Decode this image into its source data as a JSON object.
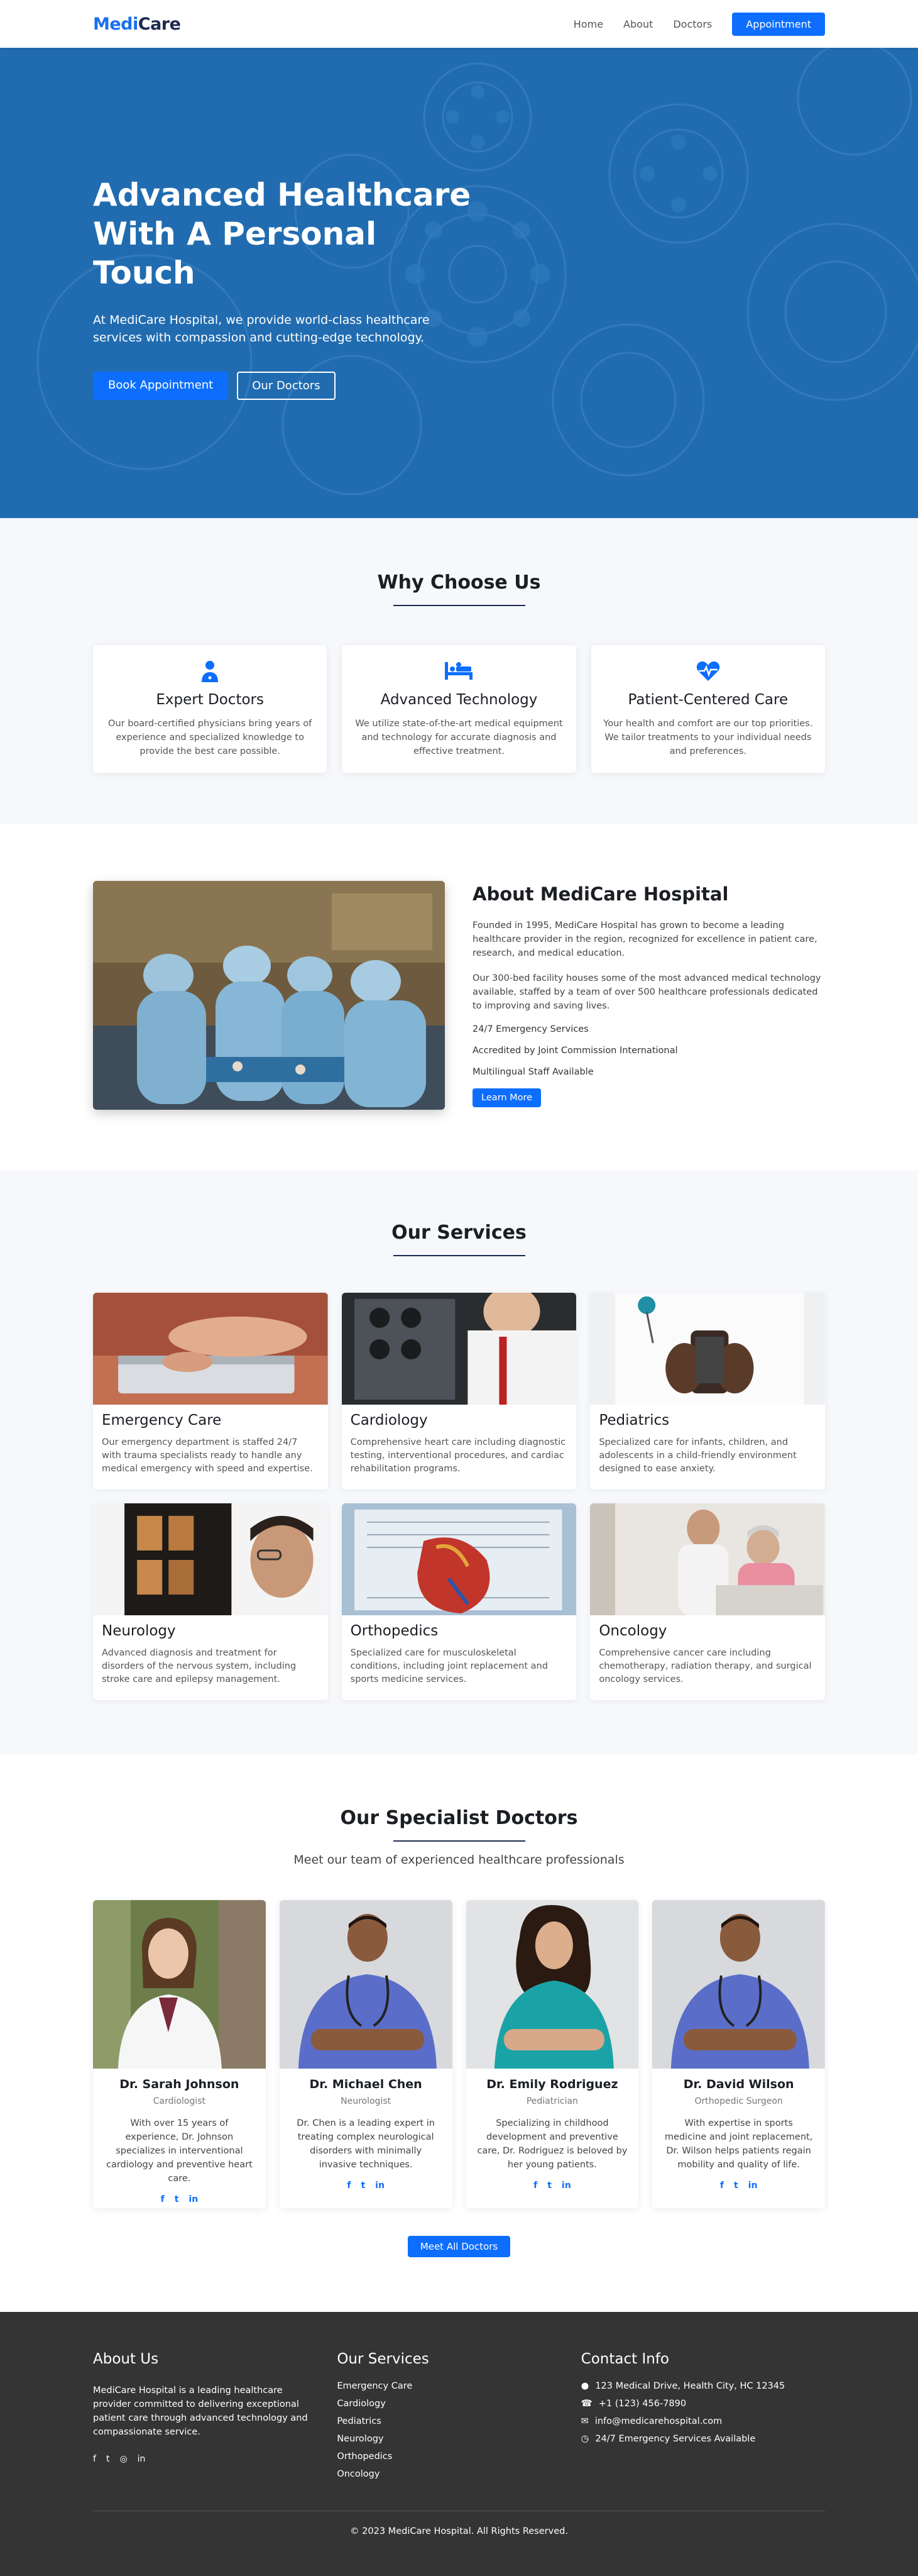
{
  "nav": {
    "logo_part1": "Medi",
    "logo_part2": "Care",
    "links": [
      "Home",
      "About",
      "Doctors"
    ],
    "cta": "Appointment"
  },
  "hero": {
    "title": "Advanced Healthcare With A Personal Touch",
    "description": "At MediCare Hospital, we provide world-class healthcare services with compassion and cutting-edge technology.",
    "primary_btn": "Book Appointment",
    "secondary_btn": "Our Doctors"
  },
  "why": {
    "title": "Why Choose Us",
    "cards": [
      {
        "icon": "doctor-icon",
        "title": "Expert Doctors",
        "text": "Our board-certified physicians bring years of experience and specialized knowledge to provide the best care possible."
      },
      {
        "icon": "hospital-bed-icon",
        "title": "Advanced Technology",
        "text": "We utilize state-of-the-art medical equipment and technology for accurate diagnosis and effective treatment."
      },
      {
        "icon": "heartbeat-icon",
        "title": "Patient-Centered Care",
        "text": "Your health and comfort are our top priorities. We tailor treatments to your individual needs and preferences."
      }
    ]
  },
  "about": {
    "title": "About MediCare Hospital",
    "para1": "Founded in 1995, MediCare Hospital has grown to become a leading healthcare provider in the region, recognized for excellence in patient care, research, and medical education.",
    "para2": "Our 300-bed facility houses some of the most advanced medical technology available, staffed by a team of over 500 healthcare professionals dedicated to improving and saving lives.",
    "features": [
      "24/7 Emergency Services",
      "Accredited by Joint Commission International",
      "Multilingual Staff Available"
    ],
    "button": "Learn More"
  },
  "services": {
    "title": "Our Services",
    "items": [
      {
        "title": "Emergency Care",
        "text": "Our emergency department is staffed 24/7 with trauma specialists ready to handle any medical emergency with speed and expertise."
      },
      {
        "title": "Cardiology",
        "text": "Comprehensive heart care including diagnostic testing, interventional procedures, and cardiac rehabilitation programs."
      },
      {
        "title": "Pediatrics",
        "text": "Specialized care for infants, children, and adolescents in a child-friendly environment designed to ease anxiety."
      },
      {
        "title": "Neurology",
        "text": "Advanced diagnosis and treatment for disorders of the nervous system, including stroke care and epilepsy management."
      },
      {
        "title": "Orthopedics",
        "text": "Specialized care for musculoskeletal conditions, including joint replacement and sports medicine services."
      },
      {
        "title": "Oncology",
        "text": "Comprehensive cancer care including chemotherapy, radiation therapy, and surgical oncology services."
      }
    ]
  },
  "doctors": {
    "title": "Our Specialist Doctors",
    "subtitle": "Meet our team of experienced healthcare professionals",
    "items": [
      {
        "name": "Dr. Sarah Johnson",
        "role": "Cardiologist",
        "bio": "With over 15 years of experience, Dr. Johnson specializes in interventional cardiology and preventive heart care."
      },
      {
        "name": "Dr. Michael Chen",
        "role": "Neurologist",
        "bio": "Dr. Chen is a leading expert in treating complex neurological disorders with minimally invasive techniques."
      },
      {
        "name": "Dr. Emily Rodriguez",
        "role": "Pediatrician",
        "bio": "Specializing in childhood development and preventive care, Dr. Rodriguez is beloved by her young patients."
      },
      {
        "name": "Dr. David Wilson",
        "role": "Orthopedic Surgeon",
        "bio": "With expertise in sports medicine and joint replacement, Dr. Wilson helps patients regain mobility and quality of life."
      }
    ],
    "button": "Meet All Doctors"
  },
  "footer": {
    "about_title": "About Us",
    "about_text": "MediCare Hospital is a leading healthcare provider committed to delivering exceptional patient care through advanced technology and compassionate service.",
    "services_title": "Our Services",
    "services": [
      "Emergency Care",
      "Cardiology",
      "Pediatrics",
      "Neurology",
      "Orthopedics",
      "Oncology"
    ],
    "contact_title": "Contact Info",
    "contact": [
      {
        "icon": "location-icon",
        "text": "123 Medical Drive, Health City, HC 12345"
      },
      {
        "icon": "phone-icon",
        "text": "+1 (123) 456-7890"
      },
      {
        "icon": "email-icon",
        "text": "info@medicarehospital.com"
      },
      {
        "icon": "clock-icon",
        "text": "24/7 Emergency Services Available"
      }
    ],
    "copyright": "© 2023 MediCare Hospital. All Rights Reserved."
  },
  "colors": {
    "primary": "#0d6efd",
    "dark": "#1b1e23",
    "footer_bg": "#343434"
  }
}
